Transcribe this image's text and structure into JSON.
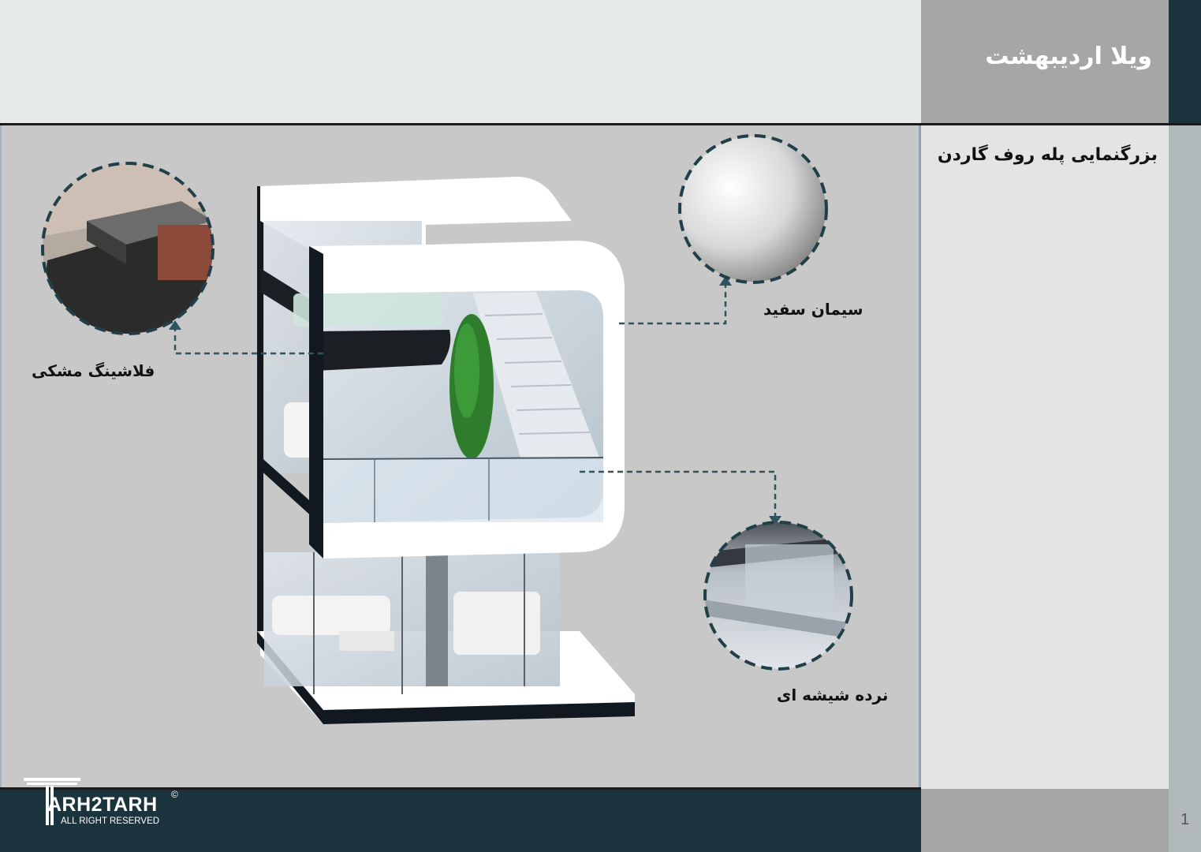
{
  "header": {
    "title": "ویلا اردیبهشت"
  },
  "side_panel": {
    "section_title": "بزرگنمایی پله روف گاردن"
  },
  "callouts": {
    "cement": "سیمان سفید",
    "flashing": "فلاشینگ مشکی",
    "glass_railing": "نرده شیشه ای"
  },
  "footer": {
    "logo_word": "ARH2TARH",
    "logo_sub": "ALL RIGHT RESERVED",
    "copyright": "©",
    "page_number": "1"
  },
  "colors": {
    "dark_teal": "#1b333d",
    "dashed_line": "#2c5560",
    "panel_gray": "#a6a6a6"
  }
}
